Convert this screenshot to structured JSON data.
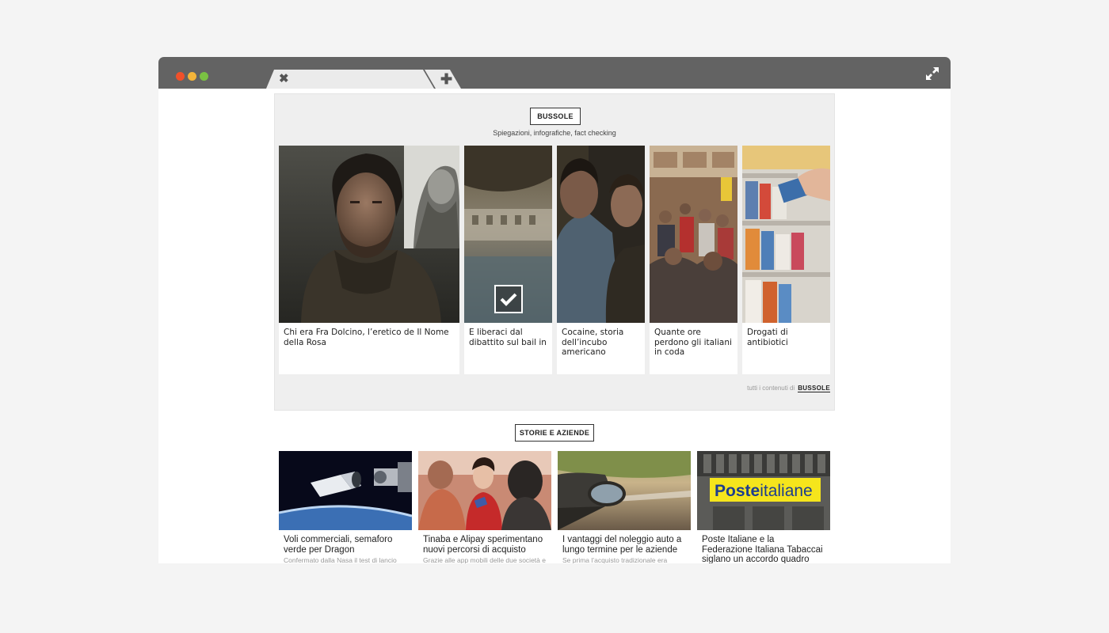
{
  "browser": {
    "tab_close_glyph": "✖",
    "tab_new_glyph": "✚"
  },
  "bussole": {
    "button_label": "BUSSOLE",
    "subtitle": "Spiegazioni, infografiche, fact checking",
    "cards": [
      {
        "title": "Chi era Fra Dolcino, l’eretico de Il Nome della Rosa"
      },
      {
        "title": "E liberaci dal dibattito sul bail in"
      },
      {
        "title": "Cocaine, storia dell’incubo americano"
      },
      {
        "title": "Quante ore perdono gli italiani in coda"
      },
      {
        "title": "Drogati di antibiotici"
      }
    ],
    "footer_text": "tutti i contenuti di",
    "footer_link": "BUSSOLE"
  },
  "storie": {
    "button_label": "STORIE E AZIENDE",
    "cards": [
      {
        "title": "Voli commerciali, semaforo verde per Dragon",
        "desc": "Confermato dalla Nasa il test di lancio"
      },
      {
        "title": "Tinaba e Alipay sperimentano nuovi percorsi di acquisto",
        "desc": "Grazie alle app mobili delle due società e"
      },
      {
        "title": "I vantaggi del noleggio auto a lungo termine per le aziende",
        "desc": "Se prima l’acquisto tradizionale era"
      },
      {
        "title": "Poste Italiane e la Federazione Italiana Tabaccai siglano un accordo quadro",
        "desc": ""
      }
    ],
    "poste_sign_prefix": "Poste",
    "poste_sign_suffix": "italiane"
  },
  "colors": {
    "titlebar": "#636363",
    "tab": "#ebebeb",
    "panel": "#efefef",
    "poste_yellow": "#f5e51c",
    "poste_blue": "#1d3d8f"
  },
  "icons": [
    "close-icon",
    "plus-icon",
    "expand-icon",
    "check-icon"
  ]
}
